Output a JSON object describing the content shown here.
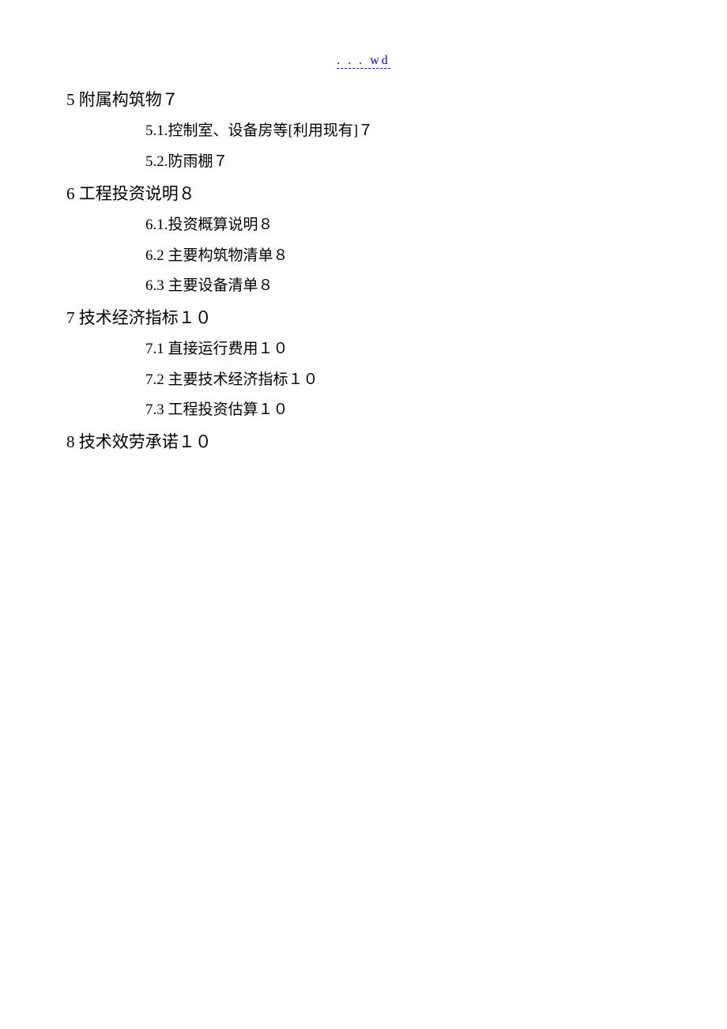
{
  "header": {
    "link_text": ". . . wd"
  },
  "toc": [
    {
      "main": "5 附属构筑物７",
      "subs": [
        "5.1.控制室、设备房等[利用现有]７",
        "5.2.防雨棚７"
      ]
    },
    {
      "main": "6 工程投资说明８",
      "subs": [
        "6.1.投资概算说明８",
        "6.2 主要构筑物清单８",
        "6.3 主要设备清单８"
      ]
    },
    {
      "main": "7  技术经济指标１０",
      "subs": [
        "7.1 直接运行费用１０",
        "7.2 主要技术经济指标１０",
        "7.3 工程投资估算１０"
      ]
    },
    {
      "main": "8 技术效劳承诺１０",
      "subs": []
    }
  ]
}
